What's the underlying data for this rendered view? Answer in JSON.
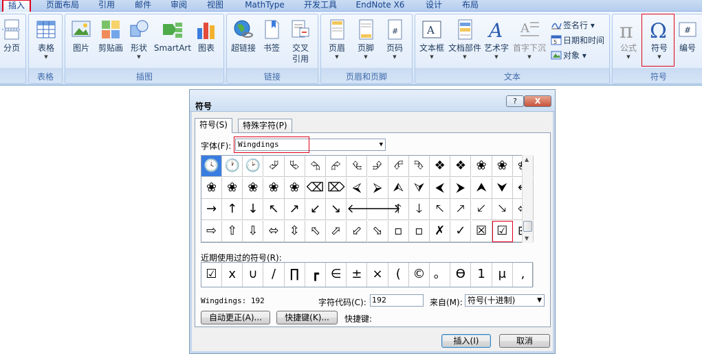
{
  "ribbon_tabs": [
    "插入",
    "页面布局",
    "引用",
    "邮件",
    "审阅",
    "视图",
    "MathType",
    "开发工具",
    "EndNote X6",
    "设计",
    "布局"
  ],
  "groups": {
    "pages": {
      "btn": "分页"
    },
    "table": {
      "label": "表格",
      "btn": "表格"
    },
    "illustrations": {
      "label": "插图",
      "btns": [
        "图片",
        "剪贴画",
        "形状",
        "SmartArt",
        "图表"
      ]
    },
    "links": {
      "label": "链接",
      "btns": [
        "超链接",
        "书签",
        "交叉\n引用"
      ]
    },
    "header_footer": {
      "label": "页眉和页脚",
      "btns": [
        "页眉",
        "页脚",
        "页码"
      ]
    },
    "text": {
      "label": "文本",
      "btns": [
        "文本框",
        "文档部件",
        "艺术字",
        "首字下沉"
      ],
      "small": [
        "签名行 ▾",
        "日期和时间",
        "对象 ▾"
      ]
    },
    "symbols": {
      "label": "符号",
      "btns": [
        "公式",
        "符号",
        "编号"
      ]
    }
  },
  "dialog": {
    "title": "符号",
    "help": "?",
    "close": "X",
    "tabs": [
      "符号(S)",
      "特殊字符(P)"
    ],
    "font_label": "字体(F):",
    "font_value": "Wingdings",
    "symbols": [
      "🕓",
      "🕐",
      "🕑",
      "⮰",
      "⮱",
      "⮲",
      "⮳",
      "⮴",
      "⮵",
      "⮶",
      "⮷",
      "❖",
      "❖",
      "❀",
      "❀",
      "❀",
      "❀",
      "❀",
      "❀",
      "❀",
      "❀",
      "⌫",
      "⌦",
      "⮘",
      "⮚",
      "⮙",
      "⮛",
      "⮜",
      "⮞",
      "⮝",
      "⮟",
      "←",
      "→",
      "↑",
      "↓",
      "↖",
      "↗",
      "↙",
      "↘",
      "🡐",
      "🡒",
      "🡑",
      "🡓",
      "🡔",
      "🡕",
      "🡗",
      "🡖",
      "⇦",
      "⇨",
      "⇧",
      "⇩",
      "⬄",
      "⇳",
      "⬁",
      "⬀",
      "⬃",
      "⬂",
      "▫",
      "▫",
      "✗",
      "✓",
      "☒",
      "☑",
      "⊞"
    ],
    "recent_label": "近期使用过的符号(R):",
    "recent": [
      "☑",
      "x",
      "∪",
      "/",
      "∏",
      "┏",
      "∈",
      "±",
      "×",
      "(",
      "©",
      "。",
      "ϴ",
      "1",
      "μ",
      ","
    ],
    "font_code_text": "Wingdings: 192",
    "char_code_label": "字符代码(C):",
    "char_code_value": "192",
    "from_label": "来自(M):",
    "from_value": "符号(十进制)",
    "autocorrect_btn": "自动更正(A)...",
    "shortcut_btn": "快捷键(K)...",
    "shortcut_label": "快捷键:",
    "insert_btn": "插入(I)",
    "cancel_btn": "取消"
  }
}
